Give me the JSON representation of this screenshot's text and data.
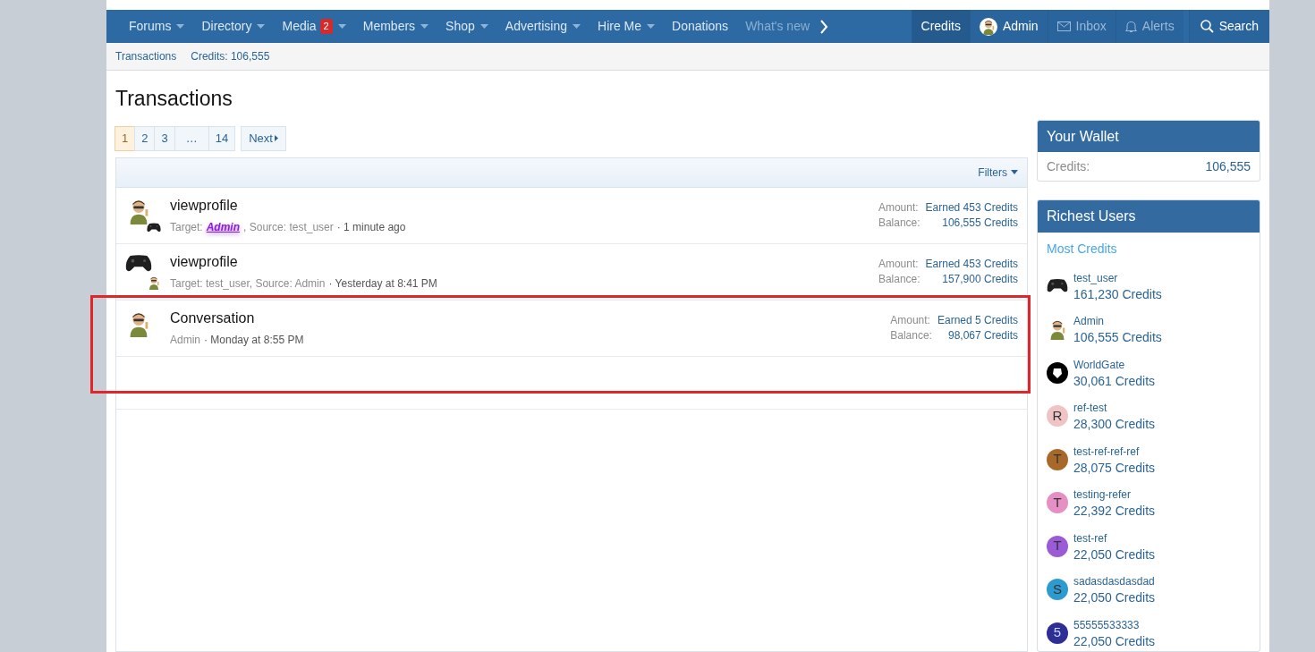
{
  "nav": {
    "items": [
      {
        "label": "Forums",
        "dropdown": true
      },
      {
        "label": "Directory",
        "dropdown": true
      },
      {
        "label": "Media",
        "dropdown": true,
        "badge": "2"
      },
      {
        "label": "Members",
        "dropdown": true
      },
      {
        "label": "Shop",
        "dropdown": true
      },
      {
        "label": "Advertising",
        "dropdown": true
      },
      {
        "label": "Hire Me",
        "dropdown": true
      },
      {
        "label": "Donations",
        "dropdown": false
      },
      {
        "label": "What's new",
        "dropdown": false,
        "faded": true
      }
    ],
    "right": [
      {
        "kind": "text",
        "label": "Credits",
        "selected": true
      },
      {
        "kind": "avatar",
        "label": "Admin",
        "selected": false
      },
      {
        "kind": "inbox",
        "label": "Inbox",
        "selected": false
      },
      {
        "kind": "bell",
        "label": "Alerts",
        "selected": false
      },
      {
        "kind": "search",
        "label": "Search",
        "selected": false
      }
    ]
  },
  "breadcrumbs": [
    "Transactions",
    "Credits: 106,555"
  ],
  "title": "Transactions",
  "pager": {
    "pages": [
      {
        "label": "1",
        "selected": true
      },
      {
        "label": "2",
        "selected": false
      },
      {
        "label": "3",
        "selected": false
      },
      {
        "label": "…",
        "selected": false
      },
      {
        "label": "14",
        "selected": false
      }
    ],
    "next": "Next"
  },
  "filters": "Filters",
  "rows": [
    {
      "title": "viewprofile",
      "avatar": {
        "kind": "figure"
      },
      "sub_avatar": {
        "kind": "controller"
      },
      "highlighted": false,
      "meta": [
        {
          "kind": "plain",
          "text": "Target:"
        },
        {
          "kind": "highlight",
          "text": "Admin"
        },
        {
          "kind": "plain",
          "text": ", Source: test_user"
        },
        {
          "kind": "time",
          "text": "· 1 minute ago"
        }
      ],
      "amount_label": "Amount:",
      "amount": "Earned 453 Credits",
      "balance_label": "Balance:",
      "balance": "106,555 Credits"
    },
    {
      "title": "viewprofile",
      "avatar": {
        "kind": "controller"
      },
      "sub_avatar": {
        "kind": "figure"
      },
      "highlighted": false,
      "meta": [
        {
          "kind": "plain",
          "text": "Target: test_user, Source: Admin"
        },
        {
          "kind": "time",
          "text": "· Yesterday at 8:41 PM"
        }
      ],
      "amount_label": "Amount:",
      "amount": "Earned 453 Credits",
      "balance_label": "Balance:",
      "balance": "157,900 Credits"
    },
    {
      "title": "Conversation",
      "avatar": {
        "kind": "figure"
      },
      "highlighted": true,
      "meta": [
        {
          "kind": "plain",
          "text": "Admin"
        },
        {
          "kind": "time",
          "text": "· Monday at 8:55 PM"
        }
      ],
      "amount_label": "Amount:",
      "amount": "Earned 5 Credits",
      "balance_label": "Balance:",
      "balance": "98,067 Credits"
    }
  ],
  "wallet": {
    "title": "Your Wallet",
    "label": "Credits:",
    "value": "106,555"
  },
  "richest": {
    "title": "Richest Users",
    "subtitle": "Most Credits",
    "users": [
      {
        "name": "test_user",
        "credits": "161,230 Credits",
        "avatar": {
          "kind": "controller"
        }
      },
      {
        "name": "Admin",
        "credits": "106,555 Credits",
        "avatar": {
          "kind": "figure"
        }
      },
      {
        "name": "WorldGate",
        "credits": "30,061 Credits",
        "avatar": {
          "kind": "emblem"
        }
      },
      {
        "name": "ref-test",
        "credits": "28,300 Credits",
        "avatar": {
          "kind": "letter"
        },
        "letter": "R",
        "color": "#f0c4c4"
      },
      {
        "name": "test-ref-ref-ref",
        "credits": "28,075 Credits",
        "avatar": {
          "kind": "letter"
        },
        "letter": "T",
        "color": "#a8682a"
      },
      {
        "name": "testing-refer",
        "credits": "22,392 Credits",
        "avatar": {
          "kind": "letter"
        },
        "letter": "T",
        "color": "#e58fc4"
      },
      {
        "name": "test-ref",
        "credits": "22,050 Credits",
        "avatar": {
          "kind": "letter"
        },
        "letter": "T",
        "color": "#9b5bd6"
      },
      {
        "name": "sadasdasdasdad",
        "credits": "22,050 Credits",
        "avatar": {
          "kind": "letter"
        },
        "letter": "S",
        "color": "#2e9bd0"
      },
      {
        "name": "55555533333",
        "credits": "22,050 Credits",
        "avatar": {
          "kind": "letter"
        },
        "letter": "5",
        "color": "#2e2f94"
      }
    ]
  }
}
